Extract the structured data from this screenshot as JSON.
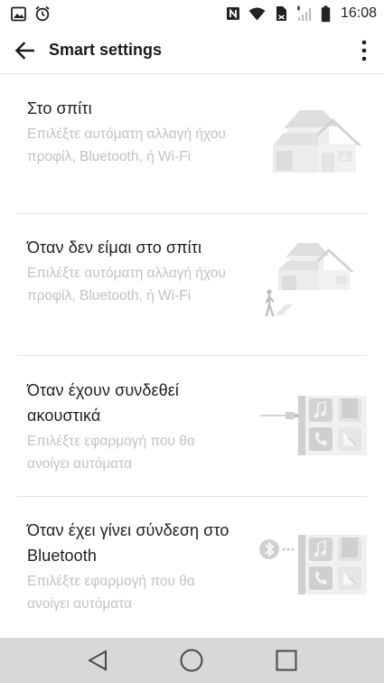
{
  "status_bar": {
    "time": "16:08",
    "left_icons": [
      "gallery-icon",
      "alarm-icon"
    ],
    "right_icons": [
      "nfc-icon",
      "wifi-icon",
      "sim-icon",
      "signal-icon",
      "battery-icon"
    ]
  },
  "app_bar": {
    "title": "Smart settings",
    "back_icon": "arrow-back-icon",
    "overflow_icon": "more-vert-icon"
  },
  "items": [
    {
      "title": "Στο σπίτι",
      "description": "Επιλέξτε αυτόματη αλλαγή ήχου προφίλ, Bluetooth, ή Wi-Fi",
      "illustration": "house-icon"
    },
    {
      "title": "Όταν δεν είμαι στο σπίτι",
      "description": "Επιλέξτε αυτόματη αλλαγή ήχου προφίλ, Bluetooth, ή Wi-Fi",
      "illustration": "house-walking-person-icon"
    },
    {
      "title": "Όταν έχουν συνδεθεί ακουστικά",
      "description": "Επιλέξτε εφαρμογή που θα ανοίγει αυτόματα",
      "illustration": "earphone-apps-icon"
    },
    {
      "title": "Όταν έχει γίνει σύνδεση στο Bluetooth",
      "description": "Επιλέξτε εφαρμογή που θα ανοίγει αυτόματα",
      "illustration": "bluetooth-apps-icon"
    }
  ],
  "nav_bar": {
    "back": "nav-back-icon",
    "home": "nav-home-icon",
    "recents": "nav-recents-icon",
    "background": "#d8d8d8"
  },
  "colors": {
    "title_text": "#1e1e1e",
    "desc_text": "#c2c2c2",
    "divider": "#e6e6e6"
  }
}
